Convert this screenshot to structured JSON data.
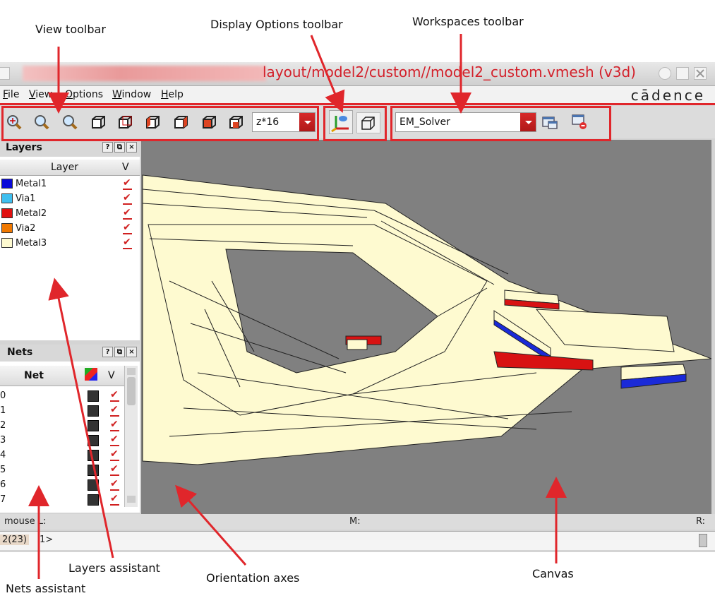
{
  "callouts": {
    "view_toolbar": "View toolbar",
    "display_options_toolbar": "Display Options toolbar",
    "workspaces_toolbar": "Workspaces toolbar",
    "layers_assistant": "Layers assistant",
    "nets_assistant": "Nets assistant",
    "orientation_axes": "Orientation axes",
    "canvas": "Canvas"
  },
  "window": {
    "title": "layout/model2/custom//model2_custom.vmesh (v3d)"
  },
  "menubar": {
    "items": [
      "File",
      "View",
      "Options",
      "Window",
      "Help"
    ],
    "brand": "cādence"
  },
  "toolbar": {
    "view_icons": [
      "zoom-fit-icon",
      "zoom-in-icon",
      "zoom-out-icon",
      "view-front-icon",
      "view-back-icon",
      "view-left-icon",
      "view-right-icon",
      "view-top-icon",
      "view-bottom-icon"
    ],
    "zoom_value": "z*16",
    "display_icons": [
      "axes-toggle-icon",
      "box-display-icon"
    ],
    "workspace_value": "EM_Solver",
    "workspace_icons": [
      "workspace-save-icon",
      "workspace-delete-icon"
    ]
  },
  "layers_panel": {
    "title": "Layers",
    "header_buttons": [
      "?",
      "⧉",
      "×"
    ],
    "col_layer": "Layer",
    "col_v": "V",
    "rows": [
      {
        "name": "Metal1",
        "color": "#0a0ad8"
      },
      {
        "name": "Via1",
        "color": "#3fbfef"
      },
      {
        "name": "Metal2",
        "color": "#e01010"
      },
      {
        "name": "Via2",
        "color": "#f07800"
      },
      {
        "name": "Metal3",
        "color": "#fefad0"
      }
    ]
  },
  "nets_panel": {
    "title": "Nets",
    "header_buttons": [
      "?",
      "⧉",
      "×"
    ],
    "col_net": "Net",
    "col_v": "V",
    "rows": [
      "0",
      "1",
      "2",
      "3",
      "4",
      "5",
      "6",
      "7"
    ]
  },
  "status": {
    "mouse_l": "mouse L:",
    "mouse_m": "M:",
    "mouse_r": "R:",
    "counter": "2(23)",
    "prompt": "1>"
  },
  "colors": {
    "accent_red": "#e0262b",
    "canvas_bg": "#808080",
    "metal3": "#fefad0"
  }
}
